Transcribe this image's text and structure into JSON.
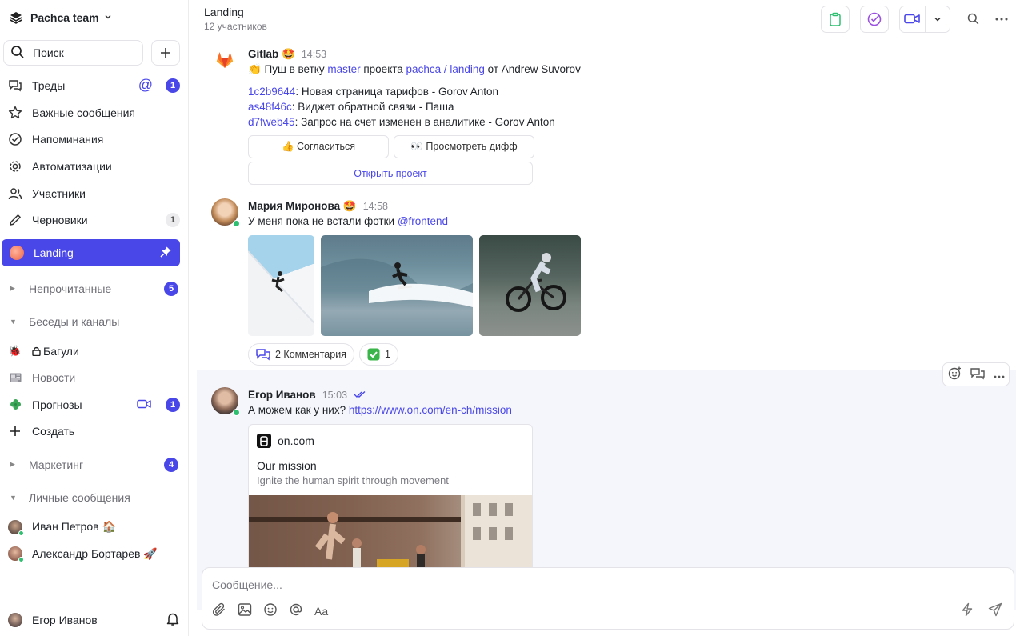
{
  "workspace": {
    "name": "Pachca team"
  },
  "search": {
    "label": "Поиск"
  },
  "nav": [
    {
      "label": "Треды",
      "badge": "1"
    },
    {
      "label": "Важные сообщения"
    },
    {
      "label": "Напоминания"
    },
    {
      "label": "Автоматизации"
    },
    {
      "label": "Участники"
    },
    {
      "label": "Черновики",
      "badge": "1"
    }
  ],
  "active_chat": {
    "label": "Landing"
  },
  "sections": {
    "unread": {
      "label": "Непрочитанные",
      "badge": "5"
    },
    "channels": {
      "label": "Беседы и каналы"
    },
    "marketing": {
      "label": "Маркетинг",
      "badge": "4"
    },
    "dms": {
      "label": "Личные сообщения"
    }
  },
  "channels": [
    {
      "label": "Багули"
    },
    {
      "label": "Новости"
    },
    {
      "label": "Прогнозы",
      "badge": "1"
    },
    {
      "label": "Создать"
    }
  ],
  "dms": [
    {
      "label": "Иван Петров 🏠"
    },
    {
      "label": "Александр Бортарев 🚀"
    }
  ],
  "current_user": {
    "name": "Егор Иванов"
  },
  "header": {
    "title": "Landing",
    "subtitle": "12 участников"
  },
  "messages": {
    "gitlab": {
      "author": "Gitlab 🤩",
      "time": "14:53",
      "push_prefix": "👏 Пуш в ветку ",
      "branch": "master",
      "push_mid": " проекта ",
      "project": "pachca / landing",
      "push_suffix": " от Andrew Suvorov",
      "commits": [
        {
          "hash": "1c2b9644",
          "text": ": Новая страница тарифов - Gorov Anton"
        },
        {
          "hash": "as48f46c",
          "text": ": Виджет обратной связи - Паша"
        },
        {
          "hash": "d7fweb45",
          "text": ": Запрос на счет изменен в аналитике - Gorov Anton"
        }
      ],
      "btn_agree": "👍 Согласиться",
      "btn_diff": "👀 Просмотреть дифф",
      "btn_open": "Открыть проект"
    },
    "maria": {
      "author": "Мария Миронова 🤩",
      "time": "14:58",
      "text": "У меня пока не встали фотки ",
      "mention": "@frontend",
      "comments": "2 Комментария",
      "reaction_count": "1"
    },
    "egor": {
      "author": "Егор Иванов",
      "time": "15:03",
      "text": "А можем как у них? ",
      "url": "https://www.on.com/en-ch/mission",
      "preview_site": "on.com",
      "preview_title": "Our mission",
      "preview_desc": "Ignite the human spirit through movement"
    }
  },
  "composer": {
    "placeholder": "Сообщение...",
    "format_label": "Aa"
  },
  "colors": {
    "accent": "#4a47e9",
    "online": "#2fbf71"
  }
}
